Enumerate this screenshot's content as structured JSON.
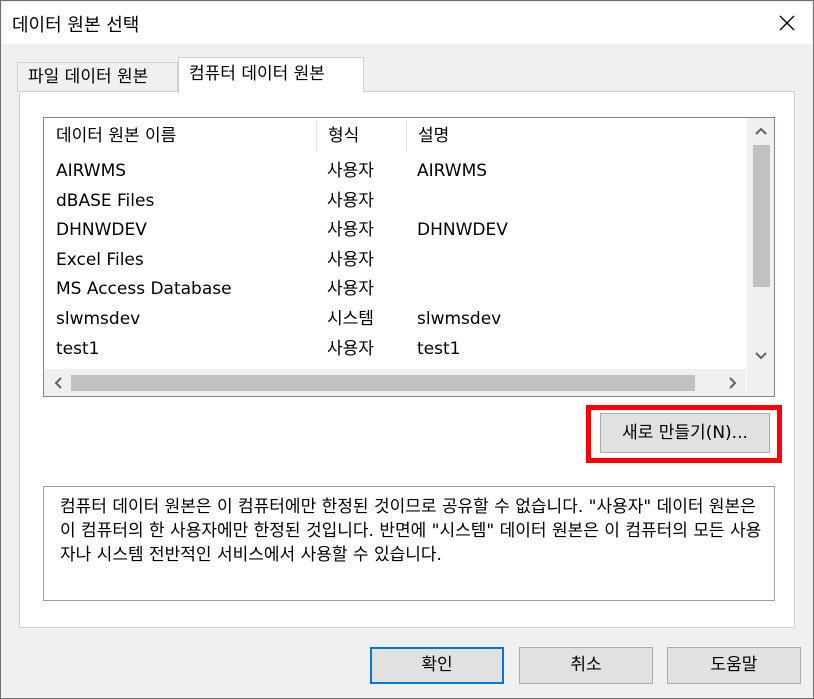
{
  "window": {
    "title": "데이터 원본 선택",
    "close_icon": "close-icon"
  },
  "tabs": [
    {
      "label": "파일 데이터 원본",
      "selected": false
    },
    {
      "label": "컴퓨터 데이터 원본",
      "selected": true
    }
  ],
  "list": {
    "columns": [
      "데이터 원본 이름",
      "형식",
      "설명"
    ],
    "rows": [
      {
        "name": "AIRWMS",
        "type": "사용자",
        "desc": "AIRWMS"
      },
      {
        "name": "dBASE Files",
        "type": "사용자",
        "desc": ""
      },
      {
        "name": "DHNWDEV",
        "type": "사용자",
        "desc": "DHNWDEV"
      },
      {
        "name": "Excel Files",
        "type": "사용자",
        "desc": ""
      },
      {
        "name": "MS Access Database",
        "type": "사용자",
        "desc": ""
      },
      {
        "name": "slwmsdev",
        "type": "시스템",
        "desc": "slwmsdev"
      },
      {
        "name": "test1",
        "type": "사용자",
        "desc": "test1"
      }
    ]
  },
  "new_button": {
    "label": "새로 만들기(N)...",
    "highlight_color": "#ff0000"
  },
  "description": "컴퓨터 데이터 원본은 이 컴퓨터에만 한정된 것이므로 공유할 수 없습니다. \"사용자\" 데이터 원본은 이 컴퓨터의 한 사용자에만 한정된 것입니다. 반면에 \"시스템\" 데이터 원본은 이 컴퓨터의 모든 사용자나 시스템 전반적인 서비스에서 사용할 수 있습니다.",
  "buttons": {
    "ok": "확인",
    "cancel": "취소",
    "help": "도움말"
  },
  "colors": {
    "ok_border": "#0078d7",
    "highlight": "#ff0000"
  }
}
